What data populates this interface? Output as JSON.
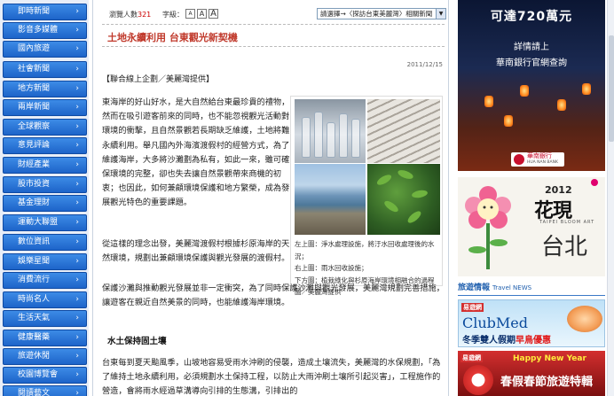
{
  "nav": {
    "items": [
      {
        "label": "即時新聞"
      },
      {
        "label": "影音多媒體"
      },
      {
        "label": "國內旅遊"
      },
      {
        "label": "社會新聞"
      },
      {
        "label": "地方新聞"
      },
      {
        "label": "兩岸新聞"
      },
      {
        "label": "全球觀察"
      },
      {
        "label": "意見評論"
      },
      {
        "label": "財經產業"
      },
      {
        "label": "股市投資"
      },
      {
        "label": "基金理財"
      },
      {
        "label": "運動大聯盟"
      },
      {
        "label": "數位資訊"
      },
      {
        "label": "娛樂星聞"
      },
      {
        "label": "消費流行"
      },
      {
        "label": "時尚名人"
      },
      {
        "label": "生活天氣"
      },
      {
        "label": "健康醫藥"
      },
      {
        "label": "旅遊休閒"
      },
      {
        "label": "校園博覽會"
      },
      {
        "label": "閱讀藝文"
      }
    ],
    "arrow": "›"
  },
  "article": {
    "views_label": "瀏覽人數",
    "views_count": "321",
    "fontsize_label": "字級：",
    "font_buttons": [
      "A",
      "A",
      "A"
    ],
    "jump_select": "請選擇→〈探訪台東美麗灣〉相關新聞",
    "title": "土地永續利用 台東觀光新契機",
    "date": "2011/12/15",
    "source": "【聯合線上企劃／美麗灣提供】",
    "para1": "東海岸的好山好水，是大自然給台東最珍貴的禮物，然而在吸引遊客前來的同時，也不能忽視觀光活動對環境的衝擊，且自然景觀若長期缺乏維護，土地將難永續利用。舉凡國內外海濱渡假村的經營方式，為了維護海岸，大多將沙灘劃為私有，如此一來，雖可確保環境的完整，卻也失去讓自然景觀帶來商機的初衷；也因此，如何兼顧環境保護和地方繁榮，成為發展觀光特色的重要課題。",
    "para2": "從這樣的理念出發，美麗灣渡假村根據杉原海岸的天然環境，規劃出兼顧環境保護與觀光發展的渡假村。",
    "para3": "保護沙灘與推動觀光發展並非一定衝突，為了同時保護沙灘與觀光發展，美麗灣規劃完善措施，讓遊客在親近自然美景的同時，也能維護海岸環境。",
    "subhead": "水土保持固土壤",
    "para4": "台東每到夏天颱風季，山坡地容易受雨水沖刷的侵襲，造成土壤流失，美麗灣的水保規劃，「為了維持土地永續利用，必須規劃水土保持工程，以防止大雨沖刷土壤所引起災害」，工程施作的營造，會將雨水經過草溝導向引排的生態溝，引排出的",
    "caption_lines": [
      "左上圖：淨水處理設施，將汙水回收處理後的水況；",
      "右上圖：雨水回收設施；",
      "下方圖：植栽綠化與杉原海岸環境相融合的過程",
      "圖／美麗灣提供"
    ]
  },
  "ads": {
    "bank": {
      "amount": "可達720萬元",
      "line1": "詳情請上",
      "line2": "華南銀行官網查詢",
      "logo_name": "華南銀行",
      "logo_en": "HUA NAN BANK"
    },
    "flora": {
      "year": "2012",
      "title": "花現",
      "sub": "TAIPEI BLOOM ART",
      "city": "台北"
    },
    "travel_heading": "旅遊情報",
    "travel_heading_en": "Travel NEWS",
    "clubmed": {
      "brand": "易遊網",
      "logo": "ClubMed",
      "slogan": "冬季雙人假期",
      "highlight": "早鳥優惠"
    },
    "xmas": {
      "brand": "易遊網",
      "greeting": "Happy New Year",
      "text": "春假春節旅遊特輯"
    }
  },
  "colors": {
    "nav_bg": "#1d64c9",
    "title": "#c0392b",
    "link_blue": "#1f5fae"
  }
}
